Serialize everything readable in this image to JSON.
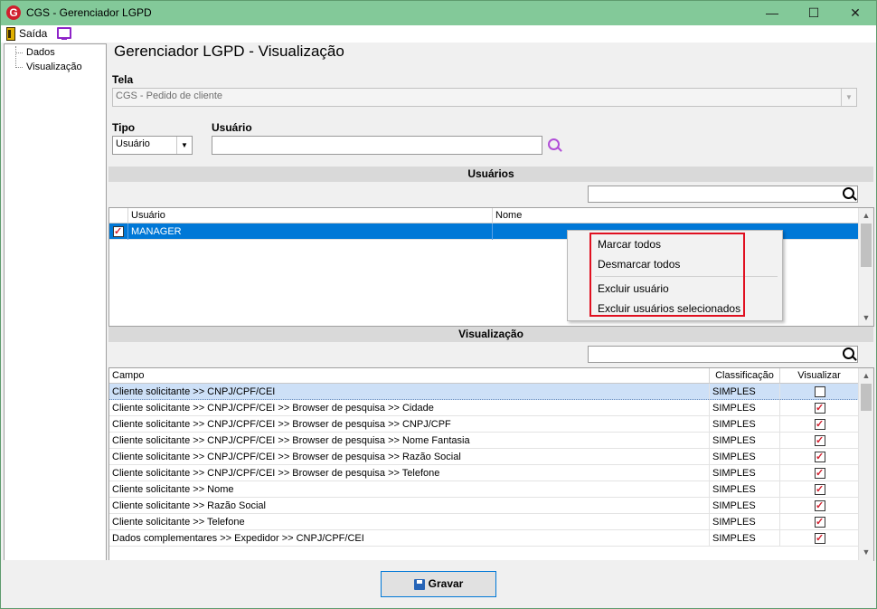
{
  "window": {
    "title": "CGS - Gerenciador LGPD",
    "logo_letter": "G"
  },
  "title_buttons": {
    "minimize": "—",
    "maximize": "☐",
    "close": "✕"
  },
  "menu": {
    "exit_label": "Saída"
  },
  "tree": {
    "items": [
      "Dados",
      "Visualização"
    ]
  },
  "page": {
    "heading": "Gerenciador LGPD - Visualização"
  },
  "form": {
    "tela_label": "Tela",
    "tela_value": "CGS - Pedido de cliente",
    "tipo_label": "Tipo",
    "tipo_value": "Usuário",
    "usuario_label": "Usuário",
    "usuario_value": ""
  },
  "users_section": {
    "title": "Usuários",
    "search_value": "",
    "columns": [
      "Usuário",
      "Nome"
    ],
    "rows": [
      {
        "checked": true,
        "usuario": "MANAGER",
        "nome": ""
      }
    ]
  },
  "context_menu": {
    "items": [
      "Marcar todos",
      "Desmarcar todos",
      "Excluir usuário",
      "Excluir usuários selecionados"
    ]
  },
  "view_section": {
    "title": "Visualização",
    "search_value": "",
    "columns": [
      "Campo",
      "Classificação",
      "Visualizar"
    ],
    "rows": [
      {
        "campo": "Cliente solicitante >> CNPJ/CPF/CEI",
        "classificacao": "SIMPLES",
        "visualizar": false
      },
      {
        "campo": "Cliente solicitante >> CNPJ/CPF/CEI >> Browser de pesquisa >> Cidade",
        "classificacao": "SIMPLES",
        "visualizar": true
      },
      {
        "campo": "Cliente solicitante >> CNPJ/CPF/CEI >> Browser de pesquisa >> CNPJ/CPF",
        "classificacao": "SIMPLES",
        "visualizar": true
      },
      {
        "campo": "Cliente solicitante >> CNPJ/CPF/CEI >> Browser de pesquisa >> Nome Fantasia",
        "classificacao": "SIMPLES",
        "visualizar": true
      },
      {
        "campo": "Cliente solicitante >> CNPJ/CPF/CEI >> Browser de pesquisa >> Razão Social",
        "classificacao": "SIMPLES",
        "visualizar": true
      },
      {
        "campo": "Cliente solicitante >> CNPJ/CPF/CEI >> Browser de pesquisa >> Telefone",
        "classificacao": "SIMPLES",
        "visualizar": true
      },
      {
        "campo": "Cliente solicitante >> Nome",
        "classificacao": "SIMPLES",
        "visualizar": true
      },
      {
        "campo": "Cliente solicitante >> Razão Social",
        "classificacao": "SIMPLES",
        "visualizar": true
      },
      {
        "campo": "Cliente solicitante >> Telefone",
        "classificacao": "SIMPLES",
        "visualizar": true
      },
      {
        "campo": "Dados complementares >> Expedidor >> CNPJ/CPF/CEI",
        "classificacao": "SIMPLES",
        "visualizar": true
      }
    ]
  },
  "footer": {
    "save_label": "Gravar"
  },
  "colors": {
    "titlebar": "#83c999",
    "selection": "#0078d7",
    "highlight_row": "#cde0f7",
    "context_outline": "#e01020",
    "check": "#d01f2d"
  }
}
